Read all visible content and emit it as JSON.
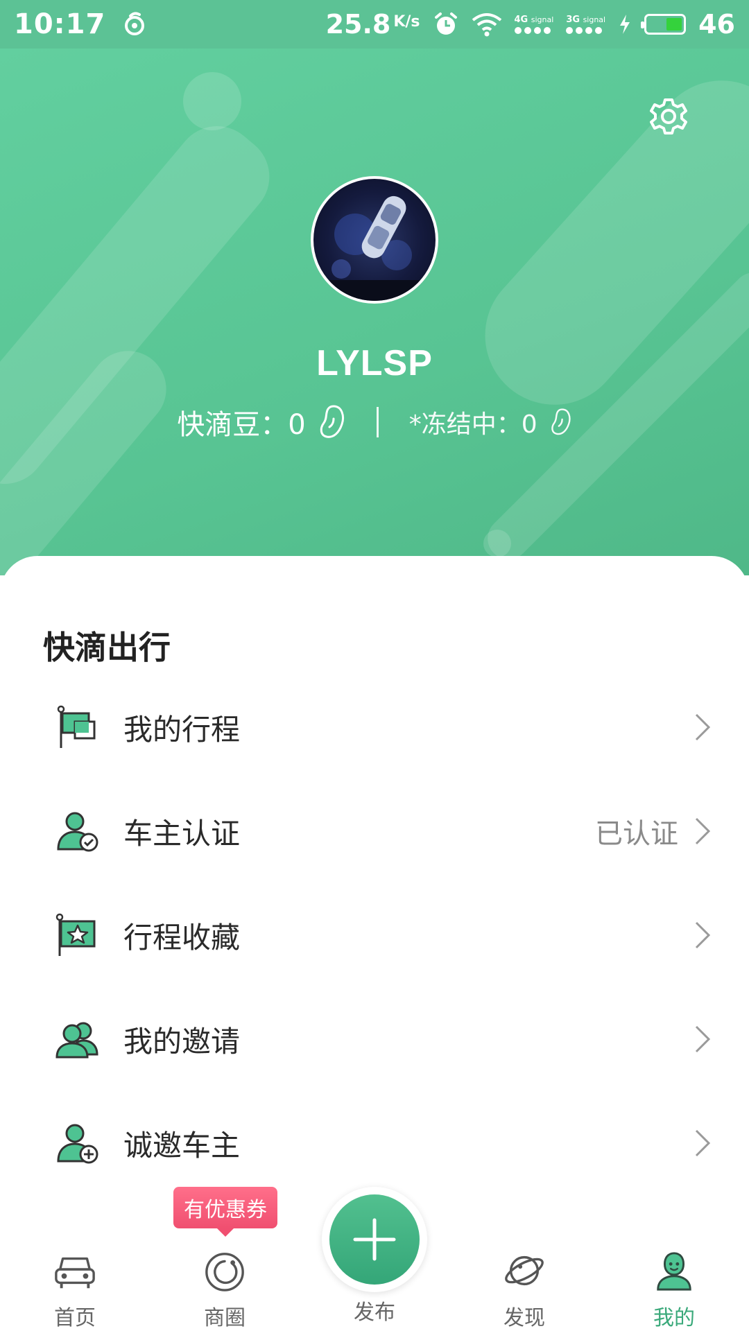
{
  "status_bar": {
    "time": "10:17",
    "speed": "25.8",
    "speed_unit": "K/s",
    "signal_1": "4G",
    "signal_2": "3G",
    "signal_small_label": "signal",
    "battery_level": "46",
    "battery_fill_fraction": 0.46
  },
  "profile": {
    "username": "LYLSP",
    "beans_label": "快滴豆：0",
    "frozen_label": "*冻结中：0"
  },
  "section": {
    "title": "快滴出行"
  },
  "menu": [
    {
      "label": "我的行程",
      "status": "",
      "icon": "flag-icon"
    },
    {
      "label": "车主认证",
      "status": "已认证",
      "icon": "user-verified-icon"
    },
    {
      "label": "行程收藏",
      "status": "",
      "icon": "flag-star-icon"
    },
    {
      "label": "我的邀请",
      "status": "",
      "icon": "users-icon"
    },
    {
      "label": "诚邀车主",
      "status": "",
      "icon": "user-add-icon"
    }
  ],
  "bottom_nav": {
    "home": "首页",
    "circle": "商圈",
    "publish": "发布",
    "discover": "发现",
    "mine": "我的",
    "coupon_badge": "有优惠券",
    "active": "mine"
  },
  "colors": {
    "header_green": "#5cc295",
    "accent_green": "#3aa97a",
    "coupon_pink": "#f04f70",
    "battery_green": "#34d23c"
  }
}
